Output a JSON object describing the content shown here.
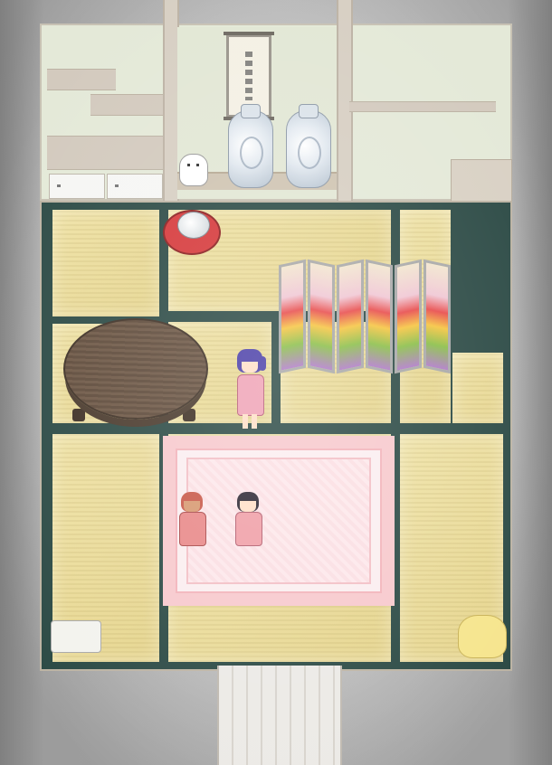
{
  "scene": {
    "type": "top-down pixel-art room",
    "objects": [
      "back-wall",
      "hanging-scroll",
      "vase-left",
      "vase-right",
      "lucky-cat",
      "drawers",
      "tea-tray",
      "teapot",
      "round-table",
      "folding-screen",
      "pink-carpet",
      "cushion",
      "plush-toy",
      "corridor"
    ],
    "characters": [
      {
        "id": "player",
        "hair": "#4b3fa8",
        "clothes": "#f0a3b6"
      },
      {
        "id": "sitting-girl-left",
        "hair": "#c95a4a",
        "clothes": "#e98a8a"
      },
      {
        "id": "sitting-girl-right",
        "hair": "#2f2a35",
        "clothes": "#f0a0a8"
      }
    ]
  },
  "colors": {
    "tatami": "#efe2a6",
    "tatami_border": "#2d4b46",
    "carpet": "#f7c9cd",
    "wall": "#e4e9d8",
    "tray": "#d6393b"
  }
}
